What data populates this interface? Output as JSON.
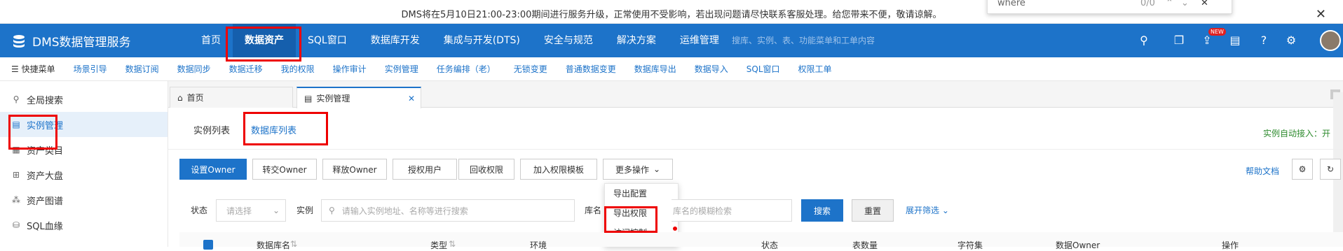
{
  "notice": {
    "text": "DMS将在5月10日21:00-23:00期间进行服务升级，正常使用不受影响，若出现问题请尽快联系客服处理。给您带来不便，敬请谅解。"
  },
  "findbar": {
    "query": "where",
    "count": "0/0"
  },
  "header": {
    "brand": "DMS数据管理服务",
    "nav": [
      "首页",
      "数据资产",
      "SQL窗口",
      "数据库开发",
      "集成与开发(DTS)",
      "安全与规范",
      "解决方案",
      "运维管理"
    ],
    "search_placeholder": "搜库、实例、表、功能菜单和工单内容",
    "new_badge": "NEW"
  },
  "quickbar": {
    "menu_label": "快捷菜单",
    "items": [
      "场景引导",
      "数据订阅",
      "数据同步",
      "数据迁移",
      "我的权限",
      "操作审计",
      "实例管理",
      "任务编排（老）",
      "无锁变更",
      "普通数据变更",
      "数据库导出",
      "数据导入",
      "SQL窗口",
      "权限工单"
    ]
  },
  "sidebar": {
    "items": [
      {
        "label": "全局搜索",
        "icon": "search-icon"
      },
      {
        "label": "实例管理",
        "icon": "instance-icon"
      },
      {
        "label": "资产类目",
        "icon": "catalog-icon"
      },
      {
        "label": "资产大盘",
        "icon": "dashboard-icon"
      },
      {
        "label": "资产图谱",
        "icon": "graph-icon"
      },
      {
        "label": "SQL血缘",
        "icon": "lineage-icon"
      }
    ]
  },
  "tabs": [
    {
      "label": "首页"
    },
    {
      "label": "实例管理"
    }
  ],
  "subtabs": {
    "instance_list": "实例列表",
    "db_list": "数据库列表",
    "auto_access": "实例自动接入：开"
  },
  "toolbar": {
    "buttons": [
      "设置Owner",
      "转交Owner",
      "释放Owner",
      "授权用户",
      "回收权限",
      "加入权限模板"
    ],
    "more": "更多操作",
    "help": "帮助文档"
  },
  "dropdown": {
    "items": [
      "导出配置",
      "导出权限",
      "访问控制"
    ]
  },
  "filters": {
    "status_label": "状态",
    "status_placeholder": "请选择",
    "instance_label": "实例",
    "instance_placeholder": "请输入实例地址、名称等进行搜索",
    "dbname_label": "库名",
    "dbname_placeholder": "库名的模糊检索",
    "search_btn": "搜索",
    "reset_btn": "重置",
    "expand": "展开筛选"
  },
  "table": {
    "headers": [
      "数据库名",
      "类型",
      "环境",
      "状态",
      "表数量",
      "字符集",
      "数据Owner",
      "操作"
    ]
  }
}
